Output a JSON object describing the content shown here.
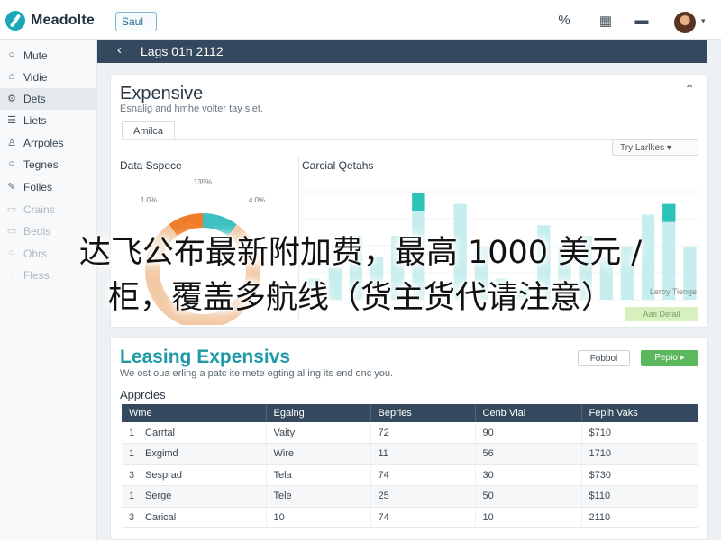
{
  "topbar": {
    "brand": "Meadolte",
    "search_label": "Saul",
    "icons": [
      "percent-icon",
      "grid-icon",
      "card-icon",
      "avatar"
    ],
    "icon_glyphs": [
      "%",
      "▦",
      "▬",
      ""
    ]
  },
  "sidebar": {
    "items": [
      {
        "label": "Mute",
        "icon": "circle-icon",
        "glyph": "○"
      },
      {
        "label": "Vidie",
        "icon": "home-icon",
        "glyph": "⌂"
      },
      {
        "label": "Dets",
        "icon": "gear-icon",
        "glyph": "⚙"
      },
      {
        "label": "Liets",
        "icon": "list-icon",
        "glyph": "☰"
      },
      {
        "label": "Arrpoles",
        "icon": "user-icon",
        "glyph": "♙"
      },
      {
        "label": "Tegnes",
        "icon": "circle-icon",
        "glyph": "○"
      },
      {
        "label": "Folles",
        "icon": "pen-icon",
        "glyph": "✎"
      },
      {
        "label": "Crains",
        "icon": "box-icon",
        "glyph": "▭"
      },
      {
        "label": "Bedis",
        "icon": "box-icon",
        "glyph": "▭"
      },
      {
        "label": "Ohrs",
        "icon": "circle-icon",
        "glyph": "○"
      },
      {
        "label": "Fless",
        "icon": "dot-icon",
        "glyph": "·"
      }
    ]
  },
  "header": {
    "back_glyph": "‹",
    "title": "Lags 01h 2112"
  },
  "expense_card": {
    "title": "Expensive",
    "subtitle": "Esnalig and hmhe volter tay slet.",
    "tab_label": "Amilca",
    "filter_label": "Try Larlkes ▾",
    "left_panel_title": "Data Sspece",
    "right_panel_title": "Carcial Qetahs",
    "apply_label": "Aas Detail",
    "legend_note": "Leroy Tienge",
    "collapse_glyph": "⌃"
  },
  "chart_data": [
    {
      "type": "pie",
      "title": "Data Sspece",
      "slices": [
        {
          "label": "1 0%",
          "value": 10,
          "color": "#f07c2a"
        },
        {
          "label": "1 0%",
          "value": 10,
          "color": "#3cc0c0"
        },
        {
          "label": "",
          "value": 80,
          "color": "#f3c9a4"
        }
      ],
      "tick_labels": [
        "135%",
        "1 0%",
        "4 0%"
      ]
    },
    {
      "type": "bar",
      "title": "Carcial Qetahs",
      "series": [
        {
          "values": [
            2,
            3,
            6,
            4,
            6,
            1,
            9,
            5,
            2,
            1,
            7,
            5,
            6,
            4,
            5,
            8,
            5
          ],
          "color": "#c6eeee"
        },
        {
          "values": [
            0,
            0,
            0,
            0,
            0,
            0,
            0,
            0,
            0,
            0,
            0,
            0,
            0,
            0,
            0,
            0,
            0
          ],
          "color": "#2cc4b8"
        }
      ],
      "highlight": [
        {
          "index": 5,
          "value": 10
        },
        {
          "index": 17,
          "value": 9
        }
      ],
      "ylim": [
        0,
        11
      ]
    }
  ],
  "leasing_card": {
    "title": "Leasing Expensivs",
    "subtitle": "We ost oua erling a patc ite mete egting al ing its end onc you.",
    "default_button": "Fobbol",
    "green_button": "Pepio ▸",
    "table_label": "Apprcies",
    "columns": [
      "Wme",
      "Egaing",
      "Bepries",
      "Cenb Vlal",
      "Fepih Vaks"
    ],
    "rows": [
      {
        "num": "1",
        "name": "Carrtal",
        "c2": "Vaity",
        "c3": "72",
        "c4": "90",
        "c5": "$710"
      },
      {
        "num": "1",
        "name": "Exgimd",
        "c2": "Wire",
        "c3": "11",
        "c4": "56",
        "c5": "1710"
      },
      {
        "num": "3",
        "name": "Sesprad",
        "c2": "Tela",
        "c3": "74",
        "c4": "30",
        "c5": "$730"
      },
      {
        "num": "1",
        "name": "Serge",
        "c2": "Tele",
        "c3": "25",
        "c4": "50",
        "c5": "$110"
      },
      {
        "num": "3",
        "name": "Carical",
        "c2": "10",
        "c3": "74",
        "c4": "10",
        "c5": "2110"
      }
    ]
  },
  "overlay": {
    "line1": "达飞公布最新附加费，最高 1000 美元 /",
    "line2": "柜，覆盖多航线（货主货代请注意）"
  },
  "colors": {
    "header_bg": "#34495e",
    "accent_teal": "#1f9aa6",
    "accent_green": "#5cb85c",
    "pie_orange": "#f07c2a"
  }
}
